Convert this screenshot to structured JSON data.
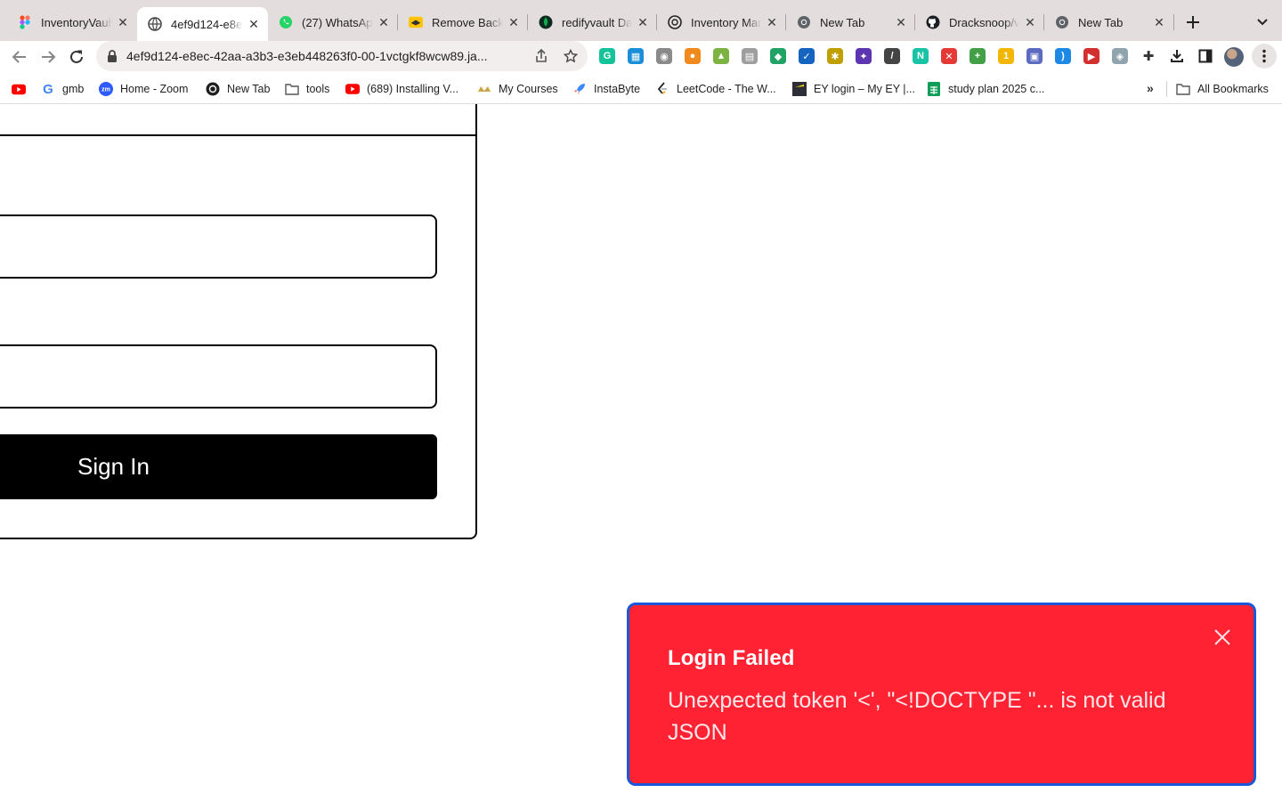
{
  "tabs": [
    {
      "title": "InventoryVault",
      "icon": "figma-icon",
      "active": false
    },
    {
      "title": "4ef9d124-e8e",
      "icon": "globe-icon",
      "active": true
    },
    {
      "title": "(27) WhatsApp",
      "icon": "whatsapp-icon",
      "active": false
    },
    {
      "title": "Remove Backg",
      "icon": "remove-bg-icon",
      "active": false
    },
    {
      "title": "redifyvault Dat",
      "icon": "mongodb-icon",
      "active": false
    },
    {
      "title": "Inventory Man",
      "icon": "chatgpt-icon",
      "active": false
    },
    {
      "title": "New Tab",
      "icon": "chrome-icon",
      "active": false
    },
    {
      "title": "Dracksnoop/v",
      "icon": "github-icon",
      "active": false
    },
    {
      "title": "New Tab",
      "icon": "chrome-icon",
      "active": false
    }
  ],
  "toolbar": {
    "url": "4ef9d124-e8ec-42aa-a3b3-e3eb448263f0-00-1vctgkf8wcw89.ja..."
  },
  "extensions": [
    {
      "name": "grammarly-icon",
      "color": "#15c39a",
      "glyph": "G"
    },
    {
      "name": "reader-extension-icon",
      "color": "#1a8fd8",
      "glyph": "▦"
    },
    {
      "name": "camera-icon",
      "color": "#8a8a8a",
      "glyph": "◉"
    },
    {
      "name": "color-picker-icon",
      "color": "#f08a1c",
      "glyph": "●"
    },
    {
      "name": "landscape-extension-icon",
      "color": "#7cb342",
      "glyph": "▲"
    },
    {
      "name": "reading-list-icon",
      "color": "#9e9e9e",
      "glyph": "▤"
    },
    {
      "name": "ai-assistant-icon",
      "color": "#21a366",
      "glyph": "◆"
    },
    {
      "name": "checkmark-extension-icon",
      "color": "#1565c0",
      "glyph": "✓"
    },
    {
      "name": "bug-extension-icon",
      "color": "#c0a000",
      "glyph": "✱"
    },
    {
      "name": "star-extension-icon",
      "color": "#5e35b1",
      "glyph": "✦"
    },
    {
      "name": "pen-icon",
      "color": "#444444",
      "glyph": "/"
    },
    {
      "name": "notion-n-icon",
      "color": "#19c3a5",
      "glyph": "N"
    },
    {
      "name": "close-x-extension-icon",
      "color": "#e53935",
      "glyph": "✕"
    },
    {
      "name": "plus-extension-icon",
      "color": "#43a047",
      "glyph": "+"
    },
    {
      "name": "number-one-extension-icon",
      "color": "#f2b705",
      "glyph": "1"
    },
    {
      "name": "picture-extension-icon",
      "color": "#5c6bc0",
      "glyph": "▣"
    },
    {
      "name": "wave-extension-icon",
      "color": "#1e88e5",
      "glyph": ")"
    },
    {
      "name": "video-extension-icon",
      "color": "#d32f2f",
      "glyph": "▶"
    },
    {
      "name": "shield-extension-icon",
      "color": "#90a4ae",
      "glyph": "◈"
    }
  ],
  "bookmarks": [
    {
      "label": "",
      "icon": "youtube-icon"
    },
    {
      "label": "gmb",
      "icon": "google-icon"
    },
    {
      "label": "Home - Zoom",
      "icon": "zoom-icon"
    },
    {
      "label": "New Tab",
      "icon": "chatgpt-icon"
    },
    {
      "label": "tools",
      "icon": "folder-icon"
    },
    {
      "label": "(689) Installing V...",
      "icon": "youtube-icon"
    },
    {
      "label": "My Courses",
      "icon": "courses-icon"
    },
    {
      "label": "InstaByte",
      "icon": "rocket-icon"
    },
    {
      "label": "LeetCode - The W...",
      "icon": "leetcode-icon"
    },
    {
      "label": "EY login – My EY |...",
      "icon": "ey-icon"
    },
    {
      "label": "study plan 2025 c...",
      "icon": "sheets-icon"
    }
  ],
  "bookmarks_more": "»",
  "all_bookmarks": "All Bookmarks",
  "form": {
    "signin_label": "Sign In"
  },
  "toast": {
    "title": "Login Failed",
    "message": "Unexpected token '<', \"<!DOCTYPE \"... is not valid JSON"
  },
  "colors": {
    "toast_bg": "#ff2233",
    "toast_border": "#1b57d6",
    "button_bg": "#000000"
  }
}
